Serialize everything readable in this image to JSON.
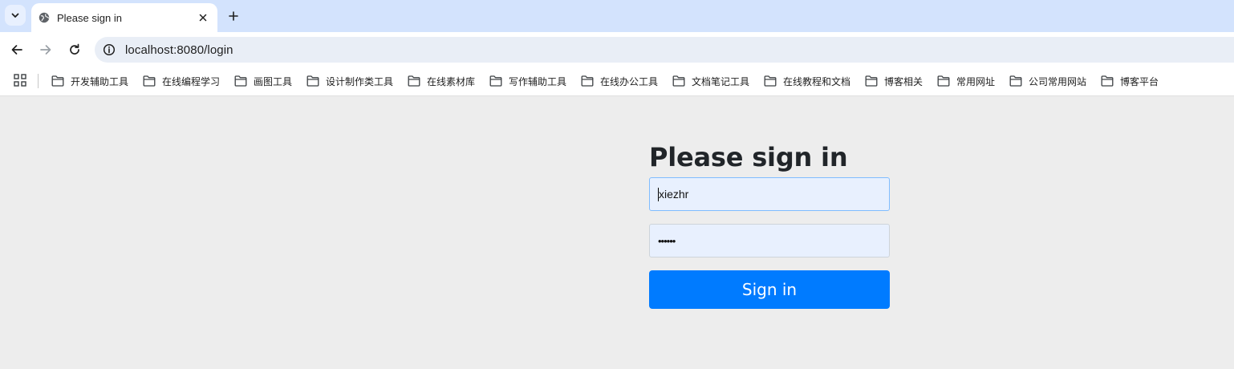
{
  "browser": {
    "tab": {
      "title": "Please sign in"
    },
    "address_bar": {
      "url": "localhost:8080/login"
    },
    "bookmarks": [
      {
        "label": "开发辅助工具"
      },
      {
        "label": "在线编程学习"
      },
      {
        "label": "画图工具"
      },
      {
        "label": "设计制作类工具"
      },
      {
        "label": "在线素材库"
      },
      {
        "label": "写作辅助工具"
      },
      {
        "label": "在线办公工具"
      },
      {
        "label": "文档笔记工具"
      },
      {
        "label": "在线教程和文档"
      },
      {
        "label": "博客相关"
      },
      {
        "label": "常用网址"
      },
      {
        "label": "公司常用网站"
      },
      {
        "label": "博客平台"
      }
    ]
  },
  "login": {
    "heading": "Please sign in",
    "username": {
      "value": "xiezhr"
    },
    "password": {
      "masked_value": "••••••"
    },
    "submit_label": "Sign in"
  },
  "colors": {
    "tabstrip": "#d3e3fd",
    "page_background": "#ededed",
    "input_background": "#e8f0fe",
    "primary_button": "#007bff"
  }
}
